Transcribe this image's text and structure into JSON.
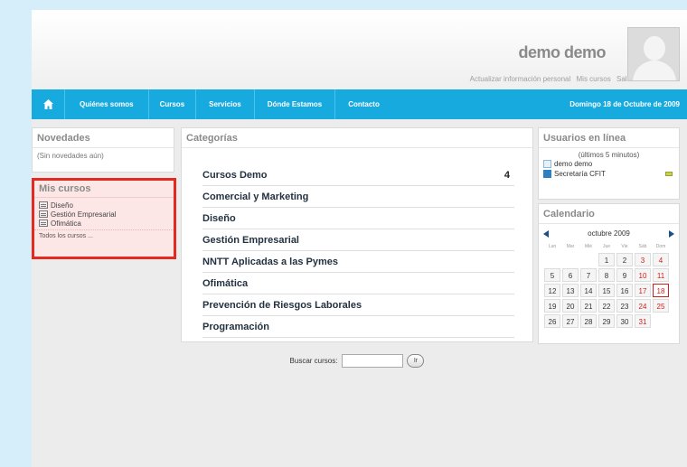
{
  "header": {
    "username": "demo demo",
    "links": [
      "Actualizar información personal",
      "Mis cursos",
      "Salir"
    ]
  },
  "nav": {
    "items": [
      "Quiénes somos",
      "Cursos",
      "Servicios",
      "Dónde Estamos",
      "Contacto"
    ],
    "date": "Domingo 18 de Octubre de 2009"
  },
  "novedades": {
    "title": "Novedades",
    "text": "(Sin novedades aún)"
  },
  "mis_cursos": {
    "title": "Mis cursos",
    "items": [
      "Diseño",
      "Gestión Empresarial",
      "Ofimática"
    ],
    "all_link": "Todos los cursos ..."
  },
  "categorias": {
    "title": "Categorías",
    "rows": [
      {
        "name": "Cursos Demo",
        "count": "4"
      },
      {
        "name": "Comercial y Marketing",
        "count": ""
      },
      {
        "name": "Diseño",
        "count": ""
      },
      {
        "name": "Gestión Empresarial",
        "count": ""
      },
      {
        "name": "NNTT Aplicadas a las Pymes",
        "count": ""
      },
      {
        "name": "Ofimática",
        "count": ""
      },
      {
        "name": "Prevención de Riesgos Laborales",
        "count": ""
      },
      {
        "name": "Programación",
        "count": ""
      }
    ]
  },
  "search": {
    "label": "Buscar cursos:",
    "value": "",
    "button": "Ir"
  },
  "usuarios": {
    "title": "Usuarios en línea",
    "subtitle": "(últimos 5 minutos)",
    "users": [
      "demo demo",
      "Secretaría CFIT"
    ]
  },
  "calendario": {
    "title": "Calendario",
    "month": "octubre 2009",
    "dow": [
      "Lun",
      "Mar",
      "Mié",
      "Jue",
      "Vie",
      "Sáb",
      "Dom"
    ],
    "days": [
      "",
      "",
      "",
      "1",
      "2",
      "3",
      "4",
      "5",
      "6",
      "7",
      "8",
      "9",
      "10",
      "11",
      "12",
      "13",
      "14",
      "15",
      "16",
      "17",
      "18",
      "19",
      "20",
      "21",
      "22",
      "23",
      "24",
      "25",
      "26",
      "27",
      "28",
      "29",
      "30",
      "31",
      ""
    ],
    "today": "18"
  },
  "colors": {
    "nav": "#17aadf",
    "highlight_border": "#e32920",
    "weekend": "#d0201a"
  }
}
